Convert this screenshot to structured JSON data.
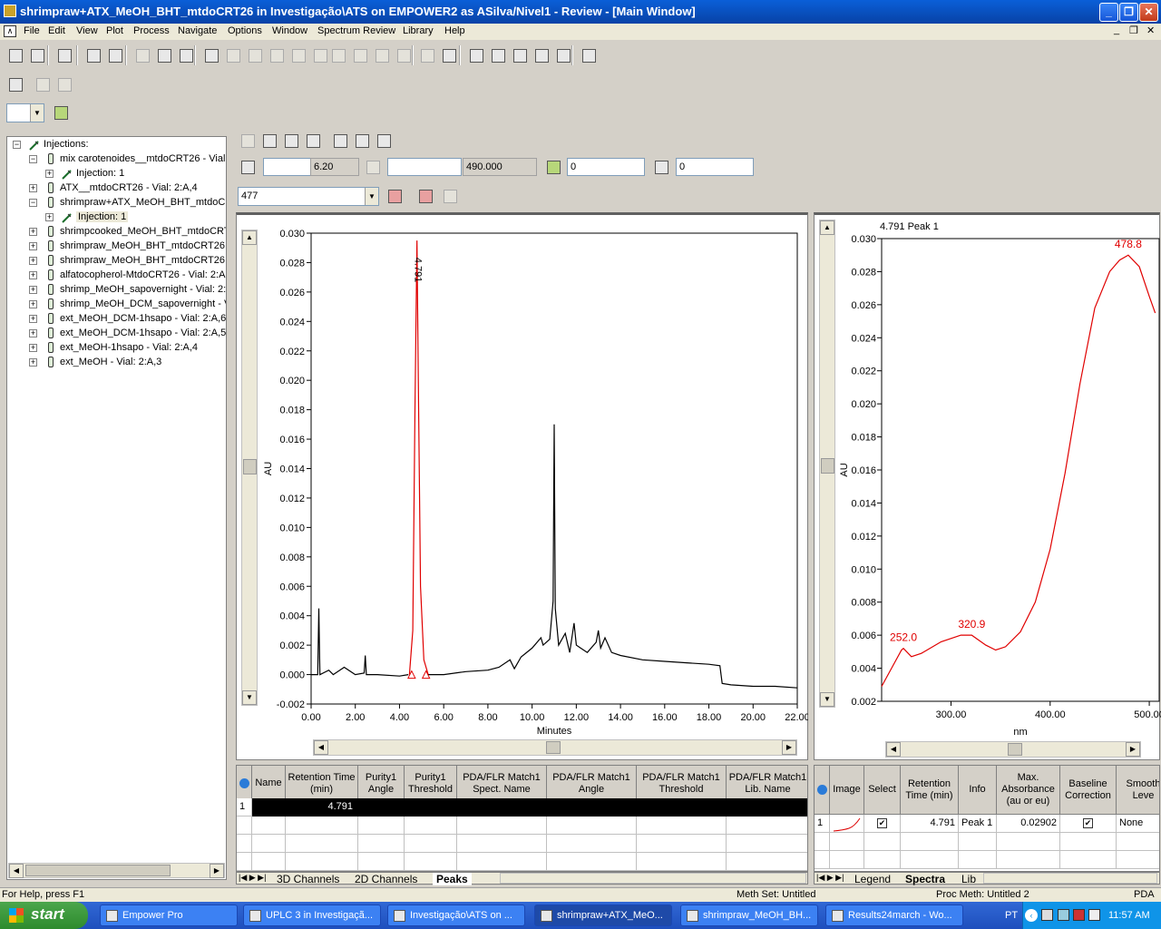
{
  "window": {
    "title": "shrimpraw+ATX_MeOH_BHT_mtdoCRT26 in Investigação\\ATS on EMPOWER2 as ASilva/Nivel1 - Review - [Main Window]"
  },
  "menu": [
    "File",
    "Edit",
    "View",
    "Plot",
    "Process",
    "Navigate",
    "Options",
    "Window",
    "Spectrum Review",
    "Library",
    "Help"
  ],
  "tree": {
    "root": "Injections:",
    "items": [
      {
        "label": "mix carotenoides__mtdoCRT26 - Vial:",
        "child": "Injection: 1"
      },
      {
        "label": "ATX__mtdoCRT26 - Vial: 2:A,4"
      },
      {
        "label": "shrimpraw+ATX_MeOH_BHT_mtdoCF",
        "child": "Injection: 1"
      },
      {
        "label": "shrimpcooked_MeOH_BHT_mtdoCRT"
      },
      {
        "label": "shrimpraw_MeOH_BHT_mtdoCRT26 -"
      },
      {
        "label": "shrimpraw_MeOH_BHT_mtdoCRT26 -"
      },
      {
        "label": "alfatocopherol-MtdoCRT26 - Vial: 2:A,"
      },
      {
        "label": "shrimp_MeOH_sapovernight - Vial: 2:A"
      },
      {
        "label": "shrimp_MeOH_DCM_sapovernight - V"
      },
      {
        "label": "ext_MeOH_DCM-1hsapo - Vial: 2:A,6"
      },
      {
        "label": "ext_MeOH_DCM-1hsapo - Vial: 2:A,5"
      },
      {
        "label": "ext_MeOH-1hsapo - Vial: 2:A,4"
      },
      {
        "label": "ext_MeOH - Vial: 2:A,3"
      }
    ]
  },
  "fields": {
    "f1": "",
    "f2": "6.20",
    "f3": "",
    "f4": "490.000",
    "f5": "0",
    "f6": "0",
    "combo": "477"
  },
  "chromatogram": {
    "chart_data": {
      "type": "line",
      "xlabel": "Minutes",
      "ylabel": "AU",
      "xlim": [
        0,
        22
      ],
      "ylim": [
        -0.002,
        0.03
      ],
      "xticks": [
        "0.00",
        "2.00",
        "4.00",
        "6.00",
        "8.00",
        "10.00",
        "12.00",
        "14.00",
        "16.00",
        "18.00",
        "20.00",
        "22.00"
      ],
      "yticks": [
        "-0.002",
        "0.000",
        "0.002",
        "0.004",
        "0.006",
        "0.008",
        "0.010",
        "0.012",
        "0.014",
        "0.016",
        "0.018",
        "0.020",
        "0.022",
        "0.024",
        "0.026",
        "0.028",
        "0.030"
      ],
      "peak_label": "4.791",
      "series": [
        {
          "color": "#000000",
          "x": [
            0,
            0.3,
            0.35,
            0.4,
            0.8,
            1,
            1.5,
            2,
            2.4,
            2.45,
            2.5,
            3,
            4,
            4.4
          ],
          "y": [
            0,
            0,
            0.0045,
            0,
            0.0003,
            0,
            0.0005,
            0,
            0.0001,
            0.0013,
            0,
            0,
            -0.0001,
            0
          ]
        },
        {
          "color": "#e00000",
          "x": [
            4.45,
            4.6,
            4.7,
            4.791,
            4.85,
            4.95,
            5.1,
            5.3
          ],
          "y": [
            0,
            0.003,
            0.018,
            0.0295,
            0.02,
            0.006,
            0.001,
            0
          ]
        },
        {
          "color": "#000000",
          "x": [
            5.3,
            6,
            7,
            8,
            8.5,
            9,
            9.2,
            9.5,
            10,
            10.4,
            10.5,
            10.8,
            10.95,
            11,
            11.05,
            11.2,
            11.5,
            11.7,
            11.9,
            12,
            12.2,
            12.5,
            12.9,
            13,
            13.1,
            13.3,
            13.6,
            14,
            15,
            16,
            17,
            18,
            18.5,
            18.6,
            19,
            20,
            21,
            22
          ],
          "y": [
            0,
            0,
            0.0002,
            0.0003,
            0.0005,
            0.001,
            0.0004,
            0.0012,
            0.0018,
            0.0025,
            0.002,
            0.0024,
            0.005,
            0.017,
            0.0045,
            0.002,
            0.0028,
            0.0015,
            0.0035,
            0.002,
            0.0018,
            0.0015,
            0.0022,
            0.003,
            0.0018,
            0.0025,
            0.0015,
            0.0013,
            0.001,
            0.0009,
            0.0008,
            0.0007,
            0.0006,
            -0.0006,
            -0.0007,
            -0.0008,
            -0.0008,
            -0.0009
          ]
        }
      ]
    }
  },
  "spectrum": {
    "title": "4.791 Peak 1",
    "chart_data": {
      "type": "line",
      "xlabel": "nm",
      "ylabel": "AU",
      "xlim": [
        230,
        510
      ],
      "ylim": [
        0.002,
        0.03
      ],
      "xticks": [
        "300.00",
        "400.00",
        "500.00"
      ],
      "yticks": [
        "0.002",
        "0.004",
        "0.006",
        "0.008",
        "0.010",
        "0.012",
        "0.014",
        "0.016",
        "0.018",
        "0.020",
        "0.022",
        "0.024",
        "0.026",
        "0.028",
        "0.030"
      ],
      "labels": [
        {
          "text": "252.0",
          "x": 252,
          "y": 0.0052
        },
        {
          "text": "320.9",
          "x": 320.9,
          "y": 0.006
        },
        {
          "text": "478.8",
          "x": 478.8,
          "y": 0.029
        }
      ],
      "series": [
        {
          "color": "#e00000",
          "x": [
            230,
            240,
            250,
            252,
            260,
            270,
            290,
            310,
            320.9,
            335,
            345,
            355,
            370,
            385,
            400,
            415,
            430,
            445,
            460,
            470,
            478.8,
            490,
            500,
            506
          ],
          "y": [
            0.0029,
            0.004,
            0.0051,
            0.0052,
            0.0047,
            0.0049,
            0.0056,
            0.006,
            0.006,
            0.0054,
            0.0051,
            0.0053,
            0.0062,
            0.008,
            0.0112,
            0.0158,
            0.0212,
            0.0258,
            0.028,
            0.0287,
            0.029,
            0.0283,
            0.0265,
            0.0255
          ]
        }
      ]
    }
  },
  "peaks_table": {
    "headers": [
      "Name",
      "Retention Time (min)",
      "Purity1 Angle",
      "Purity1 Threshold",
      "PDA/FLR Match1 Spect. Name",
      "PDA/FLR Match1 Angle",
      "PDA/FLR Match1 Threshold",
      "PDA/FLR Match1 Lib. Name"
    ],
    "row_index": "1",
    "retention": "4.791"
  },
  "bottom_tabs": [
    "3D Channels",
    "2D Channels",
    "Peaks"
  ],
  "spectra_table": {
    "headers": [
      "Image",
      "Select",
      "Retention Time (min)",
      "Info",
      "Max. Absorbance (au or eu)",
      "Baseline Correction",
      "Smooth Leve"
    ],
    "row": {
      "index": "1",
      "retention": "4.791",
      "info": "Peak 1",
      "absorbance": "0.02902",
      "smooth": "None"
    }
  },
  "right_tabs": [
    "Legend",
    "Spectra",
    "Lib"
  ],
  "status": {
    "help": "For Help, press F1",
    "meth_set": "Meth Set: Untitled",
    "proc_meth": "Proc Meth: Untitled 2",
    "mode": "PDA"
  },
  "taskbar": {
    "start": "start",
    "tasks": [
      "Empower Pro",
      "UPLC 3 in Investigaçã...",
      "Investigação\\ATS on ...",
      "shrimpraw+ATX_MeO...",
      "shrimpraw_MeOH_BH...",
      "Results24march - Wo..."
    ],
    "lang": "PT",
    "time": "11:57 AM"
  }
}
